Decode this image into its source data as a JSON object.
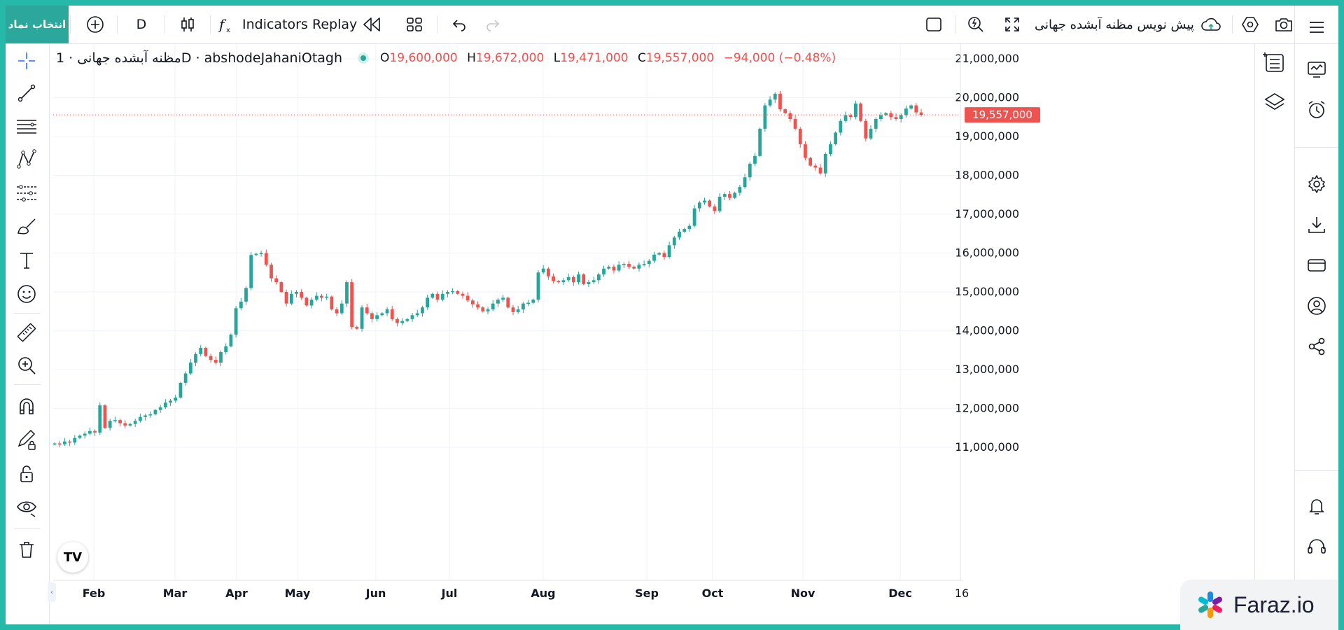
{
  "toolbar": {
    "symbol_search": "انتخاب نماد",
    "interval": "D",
    "indicators": "Indicators",
    "replay": "Replay",
    "layout_name": "پیش نویس مظنه آبشده جهانی"
  },
  "legend": {
    "title": "مظنه آبشده جهانی · 1D · abshodeJahaniOtagh",
    "open_label": "O",
    "open": "19,600,000",
    "high_label": "H",
    "high": "19,672,000",
    "low_label": "L",
    "low": "19,471,000",
    "close_label": "C",
    "close": "19,557,000",
    "change": "−94,000 (−0.48%)"
  },
  "price_label": "19,557,000",
  "brand": {
    "logo": "TV",
    "watermark": "Faraz.io"
  },
  "colors": {
    "up": "#26a69a",
    "down": "#ef5350",
    "accent": "#2ba89b",
    "price_line": "#ef5350"
  },
  "icons": {
    "left": [
      "crosshair-icon",
      "trend-line-icon",
      "fib-icon",
      "pattern-icon",
      "forecast-icon",
      "brush-icon",
      "text-icon",
      "emoji-icon",
      "ruler-icon",
      "zoom-in-icon",
      "magnet-icon",
      "lock-drawing-icon",
      "lock-icon",
      "eye-icon",
      "trash-icon"
    ],
    "right": [
      "menu-icon",
      "watchlist-icon",
      "alerts-icon",
      "settings-icon",
      "download-icon",
      "card-icon",
      "profile-icon",
      "share-icon",
      "bell-icon",
      "support-icon"
    ]
  },
  "chart_data": {
    "type": "candlestick",
    "title": "مظنه آبشده جهانی",
    "timeframe": "1D",
    "y_ticks": [
      "21,000,000",
      "20,000,000",
      "19,000,000",
      "18,000,000",
      "17,000,000",
      "16,000,000",
      "15,000,000",
      "14,000,000",
      "13,000,000",
      "12,000,000",
      "11,000,000"
    ],
    "ylim": [
      10450000,
      21250000
    ],
    "x_ticks": [
      "Feb",
      "Mar",
      "Apr",
      "May",
      "Jun",
      "Jul",
      "Aug",
      "Sep",
      "Oct",
      "Nov",
      "Dec",
      "16"
    ],
    "last_price": 19557000,
    "series_close": [
      11100000,
      11080000,
      11150000,
      11120000,
      11240000,
      11300000,
      11350000,
      11420000,
      11380000,
      12080000,
      11500000,
      11680000,
      11700000,
      11620000,
      11560000,
      11600000,
      11680000,
      11780000,
      11820000,
      11850000,
      11960000,
      12030000,
      12150000,
      12200000,
      12280000,
      12660000,
      12900000,
      13180000,
      13400000,
      13560000,
      13350000,
      13250000,
      13180000,
      13450000,
      13600000,
      13900000,
      14580000,
      14750000,
      15100000,
      15950000,
      15980000,
      16000000,
      15700000,
      15350000,
      15250000,
      15000000,
      14700000,
      14950000,
      15000000,
      14850000,
      14650000,
      14800000,
      14900000,
      14850000,
      14880000,
      14550000,
      14450000,
      14700000,
      15250000,
      14100000,
      14050000,
      14600000,
      14450000,
      14300000,
      14400000,
      14450000,
      14550000,
      14300000,
      14200000,
      14250000,
      14300000,
      14400000,
      14450000,
      14600000,
      14850000,
      14950000,
      14800000,
      14950000,
      15000000,
      15020000,
      14950000,
      14900000,
      14780000,
      14680000,
      14600000,
      14500000,
      14550000,
      14700000,
      14800000,
      14850000,
      14600000,
      14480000,
      14550000,
      14700000,
      14720000,
      14800000,
      15500000,
      15600000,
      15400000,
      15280000,
      15250000,
      15300000,
      15380000,
      15250000,
      15450000,
      15200000,
      15250000,
      15300000,
      15450000,
      15600000,
      15650000,
      15550000,
      15700000,
      15720000,
      15650000,
      15600000,
      15700000,
      15720000,
      15800000,
      15960000,
      16000000,
      15900000,
      16200000,
      16400000,
      16550000,
      16620000,
      16700000,
      17150000,
      17300000,
      17350000,
      17200000,
      17080000,
      17450000,
      17520000,
      17420000,
      17550000,
      17700000,
      17950000,
      18300000,
      18500000,
      19200000,
      19800000,
      19950000,
      20100000,
      19700000,
      19600000,
      19450000,
      19200000,
      18800000,
      18450000,
      18250000,
      18200000,
      18050000,
      18550000,
      18800000,
      19100000,
      19400000,
      19550000,
      19500000,
      19850000,
      19400000,
      18950000,
      19200000,
      19450000,
      19550000,
      19600000,
      19500000,
      19450000,
      19550000,
      19720000,
      19800000,
      19620000,
      19557000
    ]
  }
}
